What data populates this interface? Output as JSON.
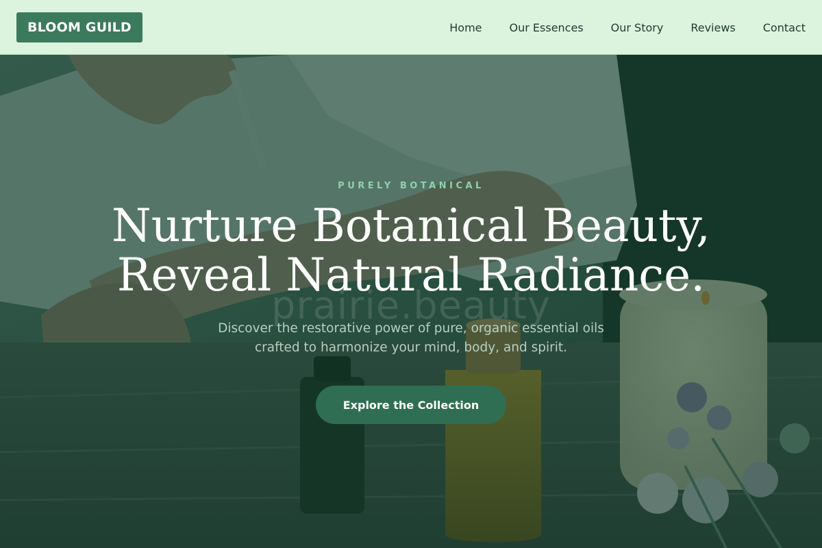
{
  "brand": {
    "name": "BLOOM GUILD"
  },
  "nav": {
    "items": [
      {
        "label": "Home"
      },
      {
        "label": "Our Essences"
      },
      {
        "label": "Our Story"
      },
      {
        "label": "Reviews"
      },
      {
        "label": "Contact"
      }
    ]
  },
  "hero": {
    "eyebrow": "PURELY BOTANICAL",
    "headline_line1": "Nurture Botanical Beauty,",
    "headline_line2": "Reveal Natural Radiance.",
    "watermark": "prairie.beauty",
    "subtext_line1": "Discover the restorative power of pure, organic essential oils",
    "subtext_line2": "crafted to harmonize your mind, body, and spirit.",
    "cta_label": "Explore the Collection"
  },
  "colors": {
    "nav_background": "#dcf3de",
    "brand_accent": "#3b7a5c",
    "cta_background": "#2f6e52",
    "eyebrow_text": "#8fd1aa",
    "hero_overlay": "#103c2a"
  },
  "icons": {
    "hero_photo": "essential-oils-photo"
  }
}
